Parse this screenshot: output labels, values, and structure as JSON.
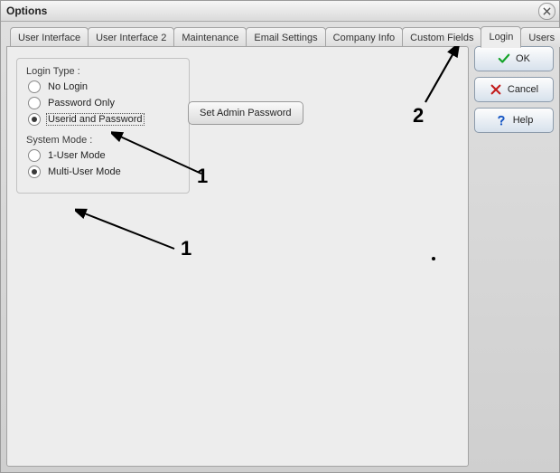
{
  "title": "Options",
  "tabs": [
    {
      "label": "User Interface"
    },
    {
      "label": "User Interface 2"
    },
    {
      "label": "Maintenance"
    },
    {
      "label": "Email Settings"
    },
    {
      "label": "Company Info"
    },
    {
      "label": "Custom Fields"
    },
    {
      "label": "Login"
    },
    {
      "label": "Users"
    }
  ],
  "active_tab_index": 6,
  "login_panel": {
    "login_type_header": "Login Type :",
    "login_type_options": [
      {
        "label": "No Login",
        "checked": false
      },
      {
        "label": "Password Only",
        "checked": false
      },
      {
        "label": "Userid and Password",
        "checked": true,
        "focused": true
      }
    ],
    "system_mode_header": "System Mode :",
    "system_mode_options": [
      {
        "label": "1-User Mode",
        "checked": false
      },
      {
        "label": "Multi-User Mode",
        "checked": true
      }
    ],
    "set_admin_button": "Set Admin Password"
  },
  "buttons": {
    "ok": "OK",
    "cancel": "Cancel",
    "help": "Help"
  },
  "icons": {
    "close": "close-icon",
    "ok": "check-icon",
    "cancel": "x-icon",
    "help": "question-icon"
  },
  "annotations": {
    "near_login_radio": "1",
    "near_multi_user": "1",
    "near_users_tab": "2"
  },
  "colors": {
    "ok_check": "#13a327",
    "cancel_x": "#c21b1b",
    "help_q": "#1857c4"
  }
}
